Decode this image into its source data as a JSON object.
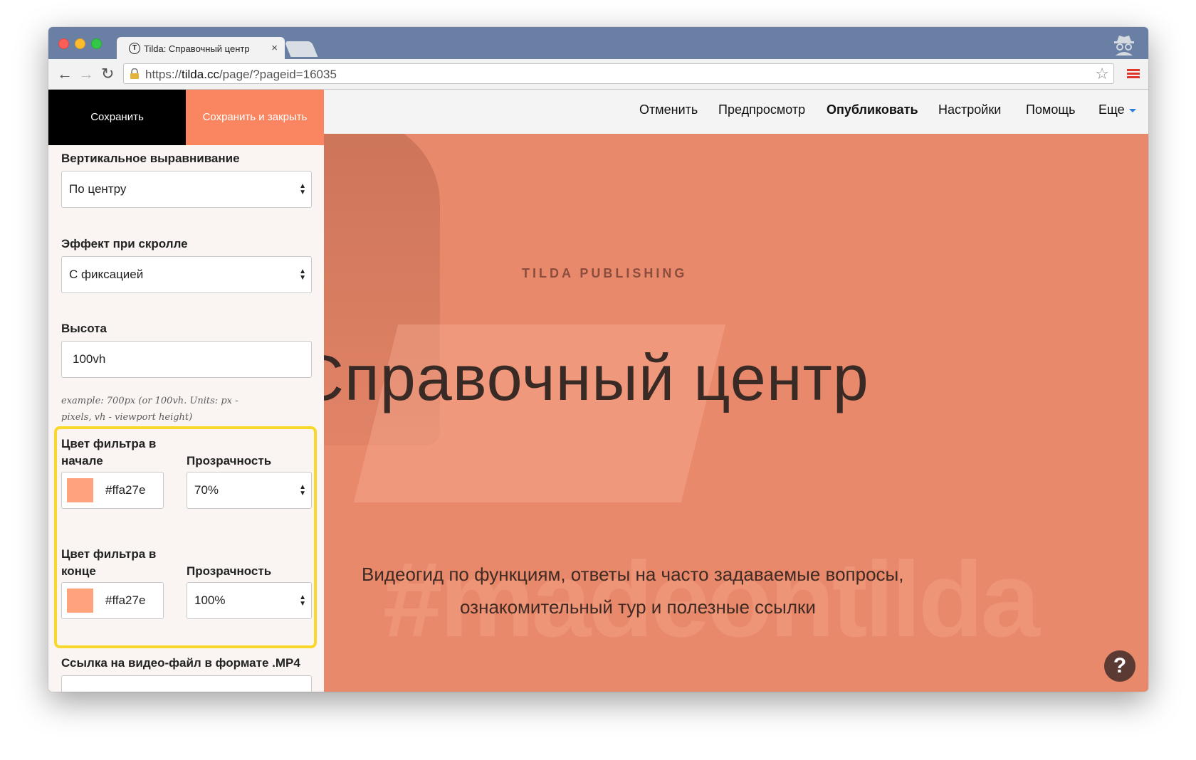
{
  "browser": {
    "tab_title": "Tilda: Справочный центр",
    "tab_close": "×",
    "url_prefix": "https://",
    "url_host": "tilda.cc",
    "url_path": "/page/?pageid=16035"
  },
  "icons": {
    "back": "back-arrow-icon",
    "forward": "forward-arrow-icon",
    "reload": "reload-icon",
    "lock": "lock-icon",
    "star": "star-icon",
    "menu": "hamburger-menu-icon",
    "incognito": "incognito-icon",
    "help": "help-icon"
  },
  "editor": {
    "save_label": "Сохранить",
    "save_close_label": "Сохранить и закрыть",
    "nav": {
      "cancel": "Отменить",
      "preview": "Предпросмотр",
      "publish": "Опубликовать",
      "settings": "Настройки",
      "help": "Помощь",
      "more": "Еще"
    }
  },
  "panel": {
    "vertical_align_label": "Вертикальное выравнивание",
    "vertical_align_value": "По центру",
    "scroll_effect_label": "Эффект при скролле",
    "scroll_effect_value": "С фиксацией",
    "height_label": "Высота",
    "height_value": "100vh",
    "height_hint": "example: 700px (or 100vh. Units: px - pixels, vh - viewport height)",
    "filter_start_label": "Цвет фильтра в начале",
    "filter_start_color": "#ffa27e",
    "filter_start_opacity_label": "Прозрачность",
    "filter_start_opacity": "70%",
    "filter_end_label": "Цвет фильтра в конце",
    "filter_end_color": "#ffa27e",
    "filter_end_opacity_label": "Прозрачность",
    "filter_end_opacity": "100%",
    "video_label": "Ссылка на видео-файл в формате .MP4"
  },
  "hero": {
    "kicker": "TILDA PUBLISHING",
    "title": "Справочный центр",
    "subtitle_line1": "Видеогид по функциям, ответы на часто задаваемые вопросы,",
    "subtitle_line2": "ознакомительный тур и полезные ссылки",
    "watermark": "#madeontilda",
    "help_glyph": "?"
  },
  "colors": {
    "accent_orange": "#f98561",
    "filter_color": "#ffa27e",
    "highlight_yellow": "#f9d82b",
    "hero_bg": "#e9896b"
  }
}
